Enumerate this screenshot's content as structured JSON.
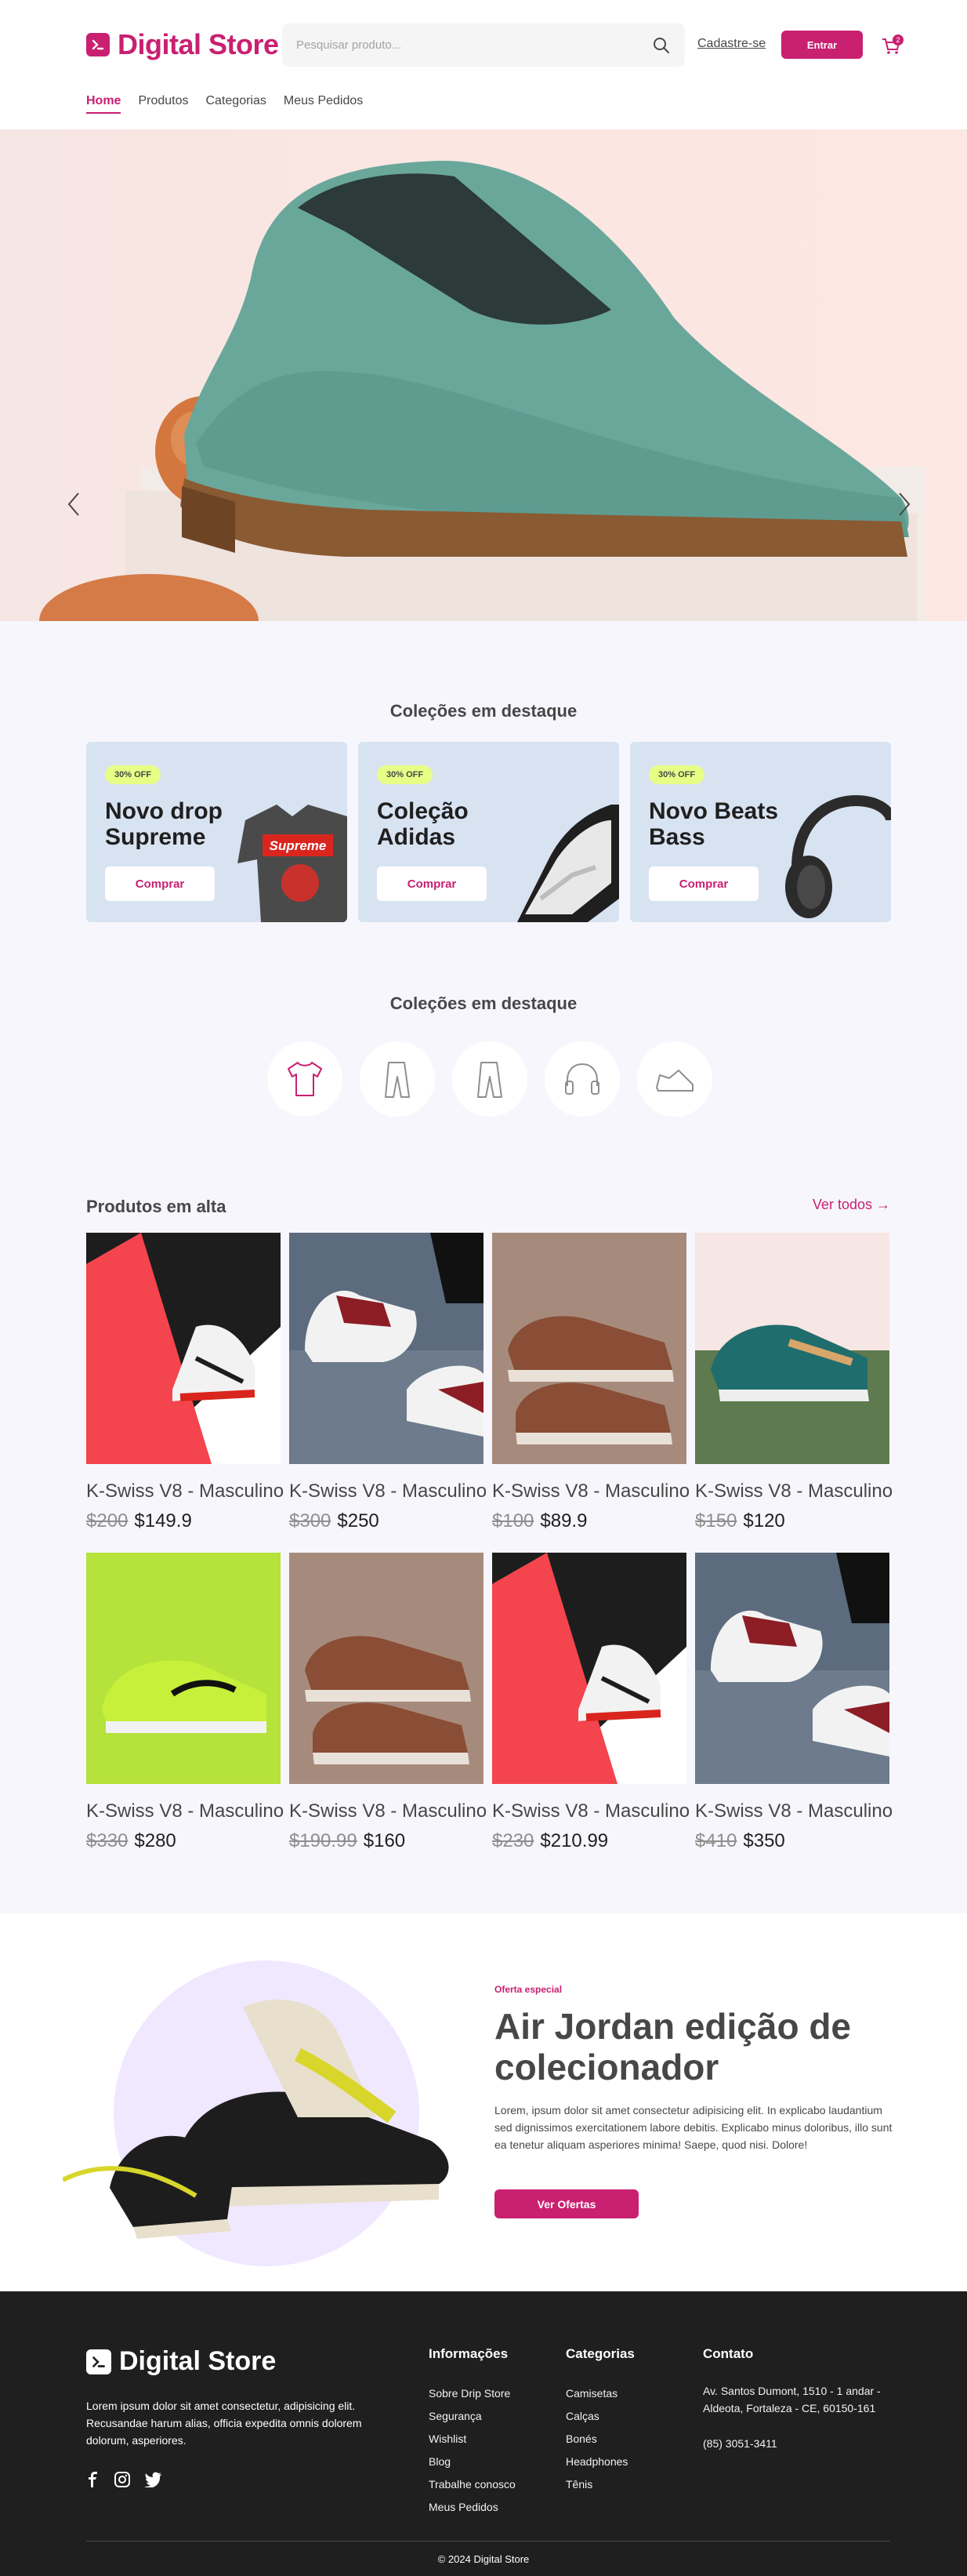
{
  "brand": {
    "name": "Digital Store",
    "color": "#c92071"
  },
  "header": {
    "search_placeholder": "Pesquisar produto...",
    "signup_label": "Cadastre-se",
    "login_label": "Entrar",
    "cart_count": "2"
  },
  "nav": {
    "items": [
      "Home",
      "Produtos",
      "Categorias",
      "Meus Pedidos"
    ],
    "active": "Home"
  },
  "collections": {
    "title": "Coleções em destaque",
    "cards": [
      {
        "badge": "30% OFF",
        "title": "Novo drop Supreme",
        "button": "Comprar"
      },
      {
        "badge": "30% OFF",
        "title": "Coleção Adidas",
        "button": "Comprar"
      },
      {
        "badge": "30% OFF",
        "title": "Novo Beats Bass",
        "button": "Comprar"
      }
    ]
  },
  "categories": {
    "title": "Coleções em destaque",
    "icons": [
      "tshirt-icon",
      "pants-icon",
      "pants-icon",
      "headphones-icon",
      "sneaker-icon"
    ]
  },
  "products": {
    "title": "Produtos em alta",
    "see_all": "Ver todos",
    "items": [
      {
        "name": "K-Swiss V8 - Masculino",
        "old": "$200",
        "price": "$149.9"
      },
      {
        "name": "K-Swiss V8 - Masculino",
        "old": "$300",
        "price": "$250"
      },
      {
        "name": "K-Swiss V8 - Masculino",
        "old": "$100",
        "price": "$89.9"
      },
      {
        "name": "K-Swiss V8 - Masculino",
        "old": "$150",
        "price": "$120"
      },
      {
        "name": "K-Swiss V8 - Masculino",
        "old": "$330",
        "price": "$280"
      },
      {
        "name": "K-Swiss V8 - Masculino",
        "old": "$190.99",
        "price": "$160"
      },
      {
        "name": "K-Swiss V8 - Masculino",
        "old": "$230",
        "price": "$210.99"
      },
      {
        "name": "K-Swiss V8 - Masculino",
        "old": "$410",
        "price": "$350"
      }
    ]
  },
  "offer": {
    "tag": "Oferta especial",
    "title": "Air Jordan edição de colecionador",
    "text": "Lorem, ipsum dolor sit amet consectetur adipisicing elit. In explicabo laudantium sed dignissimos exercitationem labore debitis. Explicabo minus doloribus, illo sunt ea tenetur aliquam asperiores minima! Saepe, quod nisi. Dolore!",
    "button": "Ver Ofertas"
  },
  "footer": {
    "brand": "Digital Store",
    "about": "Lorem ipsum dolor sit amet consectetur, adipisicing elit. Recusandae harum alias, officia expedita omnis dolorem dolorum, asperiores.",
    "info": {
      "title": "Informações",
      "items": [
        "Sobre Drip Store",
        "Segurança",
        "Wishlist",
        "Blog",
        "Trabalhe conosco",
        "Meus Pedidos"
      ]
    },
    "categories": {
      "title": "Categorias",
      "items": [
        "Camisetas",
        "Calças",
        "Bonés",
        "Headphones",
        "Tênis"
      ]
    },
    "contact": {
      "title": "Contato",
      "address": "Av. Santos Dumont, 1510 - 1 andar - Aldeota, Fortaleza - CE, 60150-161",
      "phone": "(85) 3051-3411"
    },
    "copyright": "© 2024 Digital Store"
  }
}
